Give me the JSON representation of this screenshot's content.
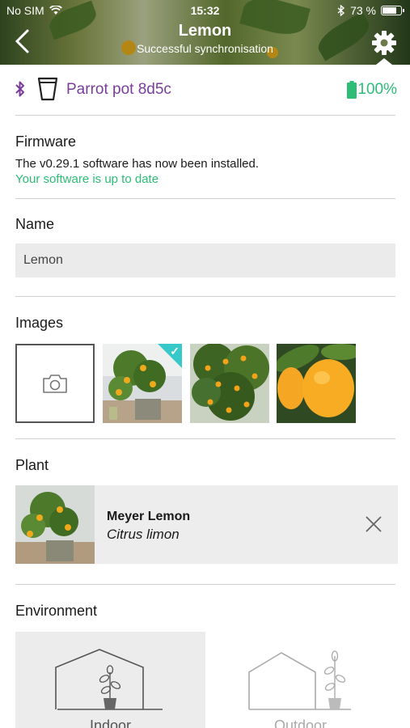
{
  "status_bar": {
    "carrier": "No SIM",
    "time": "15:32",
    "battery": "73 %"
  },
  "header": {
    "title": "Lemon",
    "subtitle": "Successful synchronisation"
  },
  "device": {
    "name": "Parrot pot 8d5c",
    "battery": "100%",
    "battery_level": 1.0,
    "name_color": "#7b3d9b",
    "ok_color": "#2dbd76"
  },
  "firmware": {
    "heading": "Firmware",
    "message": "The v0.29.1 software has now been installed.",
    "status": "Your software is up to date"
  },
  "name_section": {
    "heading": "Name",
    "value": "Lemon"
  },
  "images": {
    "heading": "Images",
    "selected_index": 1
  },
  "plant": {
    "heading": "Plant",
    "common_name": "Meyer Lemon",
    "latin_name": "Citrus limon"
  },
  "environment": {
    "heading": "Environment",
    "options": [
      "Indoor",
      "Outdoor"
    ],
    "selected": "Indoor"
  }
}
